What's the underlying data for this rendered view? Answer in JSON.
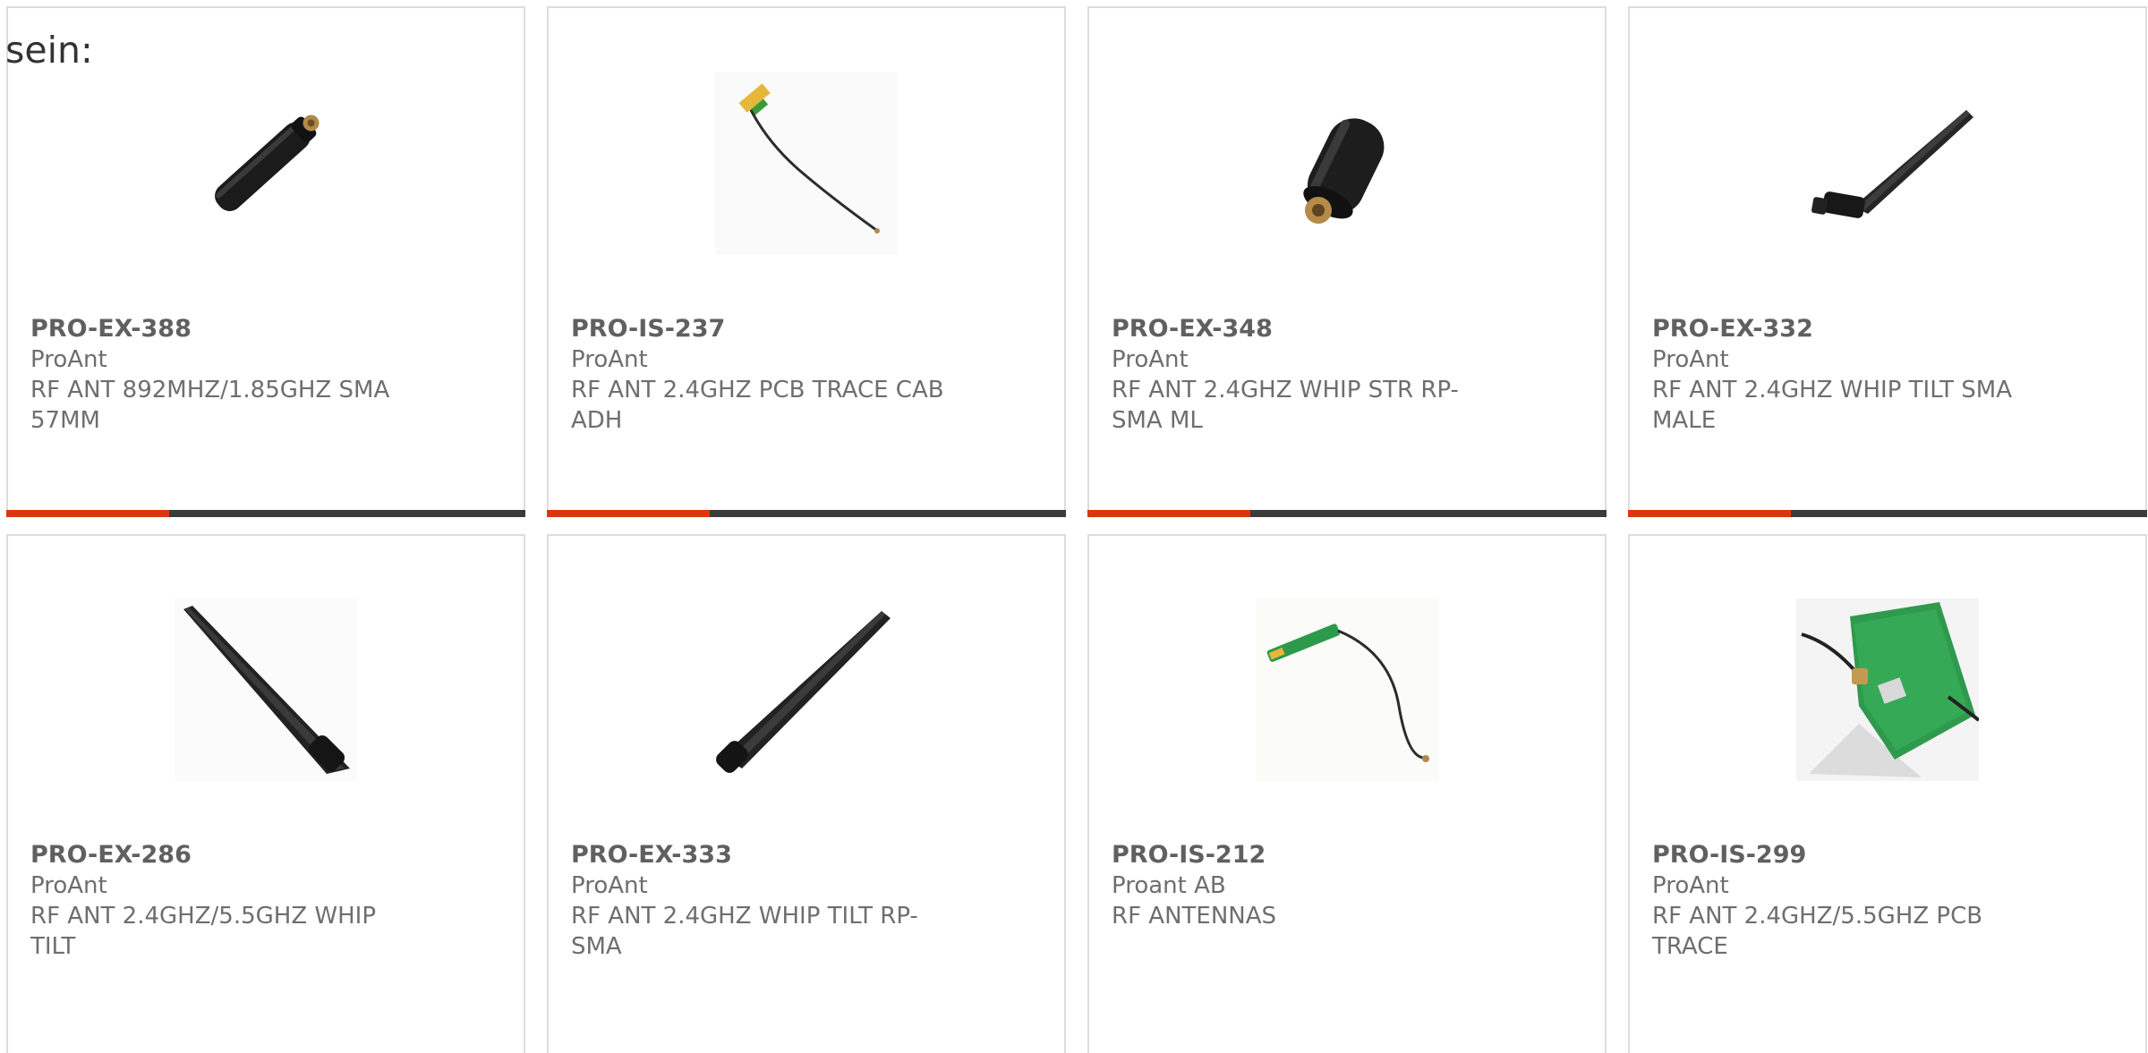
{
  "intro_text": "sein:",
  "colors": {
    "accent": "#dd3512",
    "bar": "#3b3b3b",
    "border": "#dddddd"
  },
  "products": [
    {
      "part": "PRO-EX-388",
      "manufacturer": "ProAnt",
      "desc1": "RF ANT 892MHZ/1.85GHZ SMA",
      "desc2": "57MM",
      "image": "black stubby antenna"
    },
    {
      "part": "PRO-IS-237",
      "manufacturer": "ProAnt",
      "desc1": "RF ANT 2.4GHZ PCB TRACE CAB",
      "desc2": "ADH",
      "image": "pcb trace antenna with cable"
    },
    {
      "part": "PRO-EX-348",
      "manufacturer": "ProAnt",
      "desc1": "RF ANT 2.4GHZ WHIP STR RP-",
      "desc2": "SMA ML",
      "image": "short black stub antenna"
    },
    {
      "part": "PRO-EX-332",
      "manufacturer": "ProAnt",
      "desc1": "RF ANT 2.4GHZ WHIP TILT SMA",
      "desc2": "MALE",
      "image": "tilt whip antenna"
    },
    {
      "part": "PRO-EX-286",
      "manufacturer": "ProAnt",
      "desc1": "RF ANT 2.4GHZ/5.5GHZ WHIP",
      "desc2": "TILT",
      "image": "long whip antenna"
    },
    {
      "part": "PRO-EX-333",
      "manufacturer": "ProAnt",
      "desc1": "RF ANT 2.4GHZ WHIP TILT RP-",
      "desc2": "SMA",
      "image": "whip antenna"
    },
    {
      "part": "PRO-IS-212",
      "manufacturer": "Proant AB",
      "desc1": "RF ANTENNAS",
      "desc2": "",
      "image": "flex pcb antenna with cable"
    },
    {
      "part": "PRO-IS-299",
      "manufacturer": "ProAnt",
      "desc1": "RF ANT 2.4GHZ/5.5GHZ PCB",
      "desc2": "TRACE",
      "image": "green pcb antenna"
    }
  ]
}
